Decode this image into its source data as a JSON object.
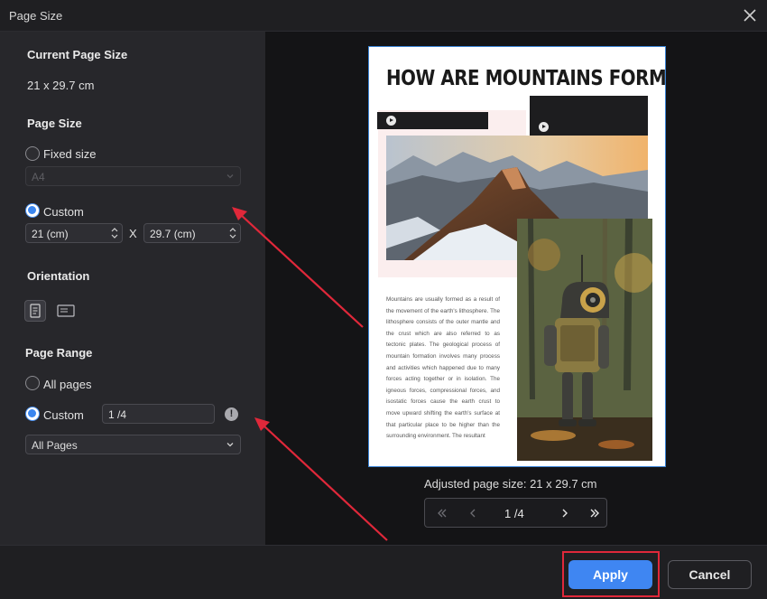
{
  "window": {
    "title": "Page Size"
  },
  "left": {
    "current_size": {
      "title": "Current Page Size",
      "value": "21 x 29.7 cm"
    },
    "page_size": {
      "title": "Page Size",
      "fixed_label": "Fixed size",
      "fixed_select": "A4",
      "custom_label": "Custom",
      "width_value": "21 (cm)",
      "height_value": "29.7 (cm)",
      "separator": "X",
      "selected": "custom"
    },
    "orientation": {
      "title": "Orientation",
      "selected": "portrait"
    },
    "page_range": {
      "title": "Page Range",
      "all_label": "All pages",
      "custom_label": "Custom",
      "custom_value": "1 /4",
      "info_glyph": "!",
      "subset_select": "All Pages",
      "selected": "custom"
    }
  },
  "preview": {
    "headline": "HOW ARE MOUNTAINS FORMED?",
    "body": "Mountains are usually formed as a result of the movement of the earth's lithosphere. The lithosphere consists of the outer mantle and the crust which are also referred to as tectonic plates. The geological process of mountain formation involves many process and activities which happened due to many forces acting together or in isolation. The igneous forces, compressional forces, and isostatic forces cause the earth crust to move upward shifting the earth's surface at that particular place to be higher than the surrounding environment. The resultant",
    "adjusted_label": "Adjusted page size: 21 x 29.7 cm",
    "pager": {
      "current": "1",
      "total": "/4"
    }
  },
  "footer": {
    "apply_label": "Apply",
    "cancel_label": "Cancel"
  },
  "colors": {
    "accent": "#3f86f2",
    "annotation": "#e0283a"
  }
}
